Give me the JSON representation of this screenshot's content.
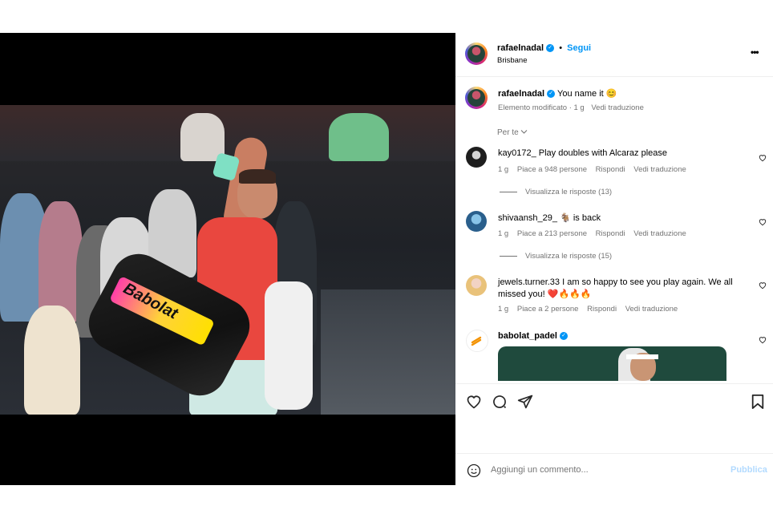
{
  "post": {
    "author": "rafaelnadal",
    "follow_label": "Segui",
    "location": "Brisbane",
    "caption": "You name it 😊",
    "caption_meta": "Elemento modificato · 1 g",
    "caption_translate": "Vedi traduzione",
    "more_label": "•••"
  },
  "sort": {
    "label": "Per te"
  },
  "comments": [
    {
      "user": "kay0172_",
      "text": "Play doubles with Alcaraz please",
      "age": "1 g",
      "likes": "Piace a 948 persone",
      "reply": "Rispondi",
      "translate": "Vedi traduzione",
      "replies": "Visualizza le risposte (13)"
    },
    {
      "user": "shivaansh_29_",
      "text": "🐐 is back",
      "age": "1 g",
      "likes": "Piace a 213 persone",
      "reply": "Rispondi",
      "translate": "Vedi traduzione",
      "replies": "Visualizza le risposte (15)"
    },
    {
      "user": "jewels.turner.33",
      "text": "I am so happy to see you play again. We all missed you! ❤️🔥🔥🔥",
      "age": "1 g",
      "likes": "Piace a 2 persone",
      "reply": "Rispondi",
      "translate": "Vedi traduzione"
    },
    {
      "user": "babolat_padel",
      "verified": true
    }
  ],
  "composer": {
    "placeholder": "Aggiungi un commento...",
    "publish": "Pubblica"
  },
  "icons": [
    "heart-icon",
    "comment-icon",
    "share-icon",
    "bookmark-icon",
    "emoji-icon",
    "user-tag-icon",
    "verified-icon",
    "chevron-down-icon"
  ],
  "media": {
    "bag_brand": "Babolat"
  },
  "colors": {
    "link": "#0095f6",
    "verified": "#0095f6",
    "publish_disabled": "#b3dbff"
  }
}
